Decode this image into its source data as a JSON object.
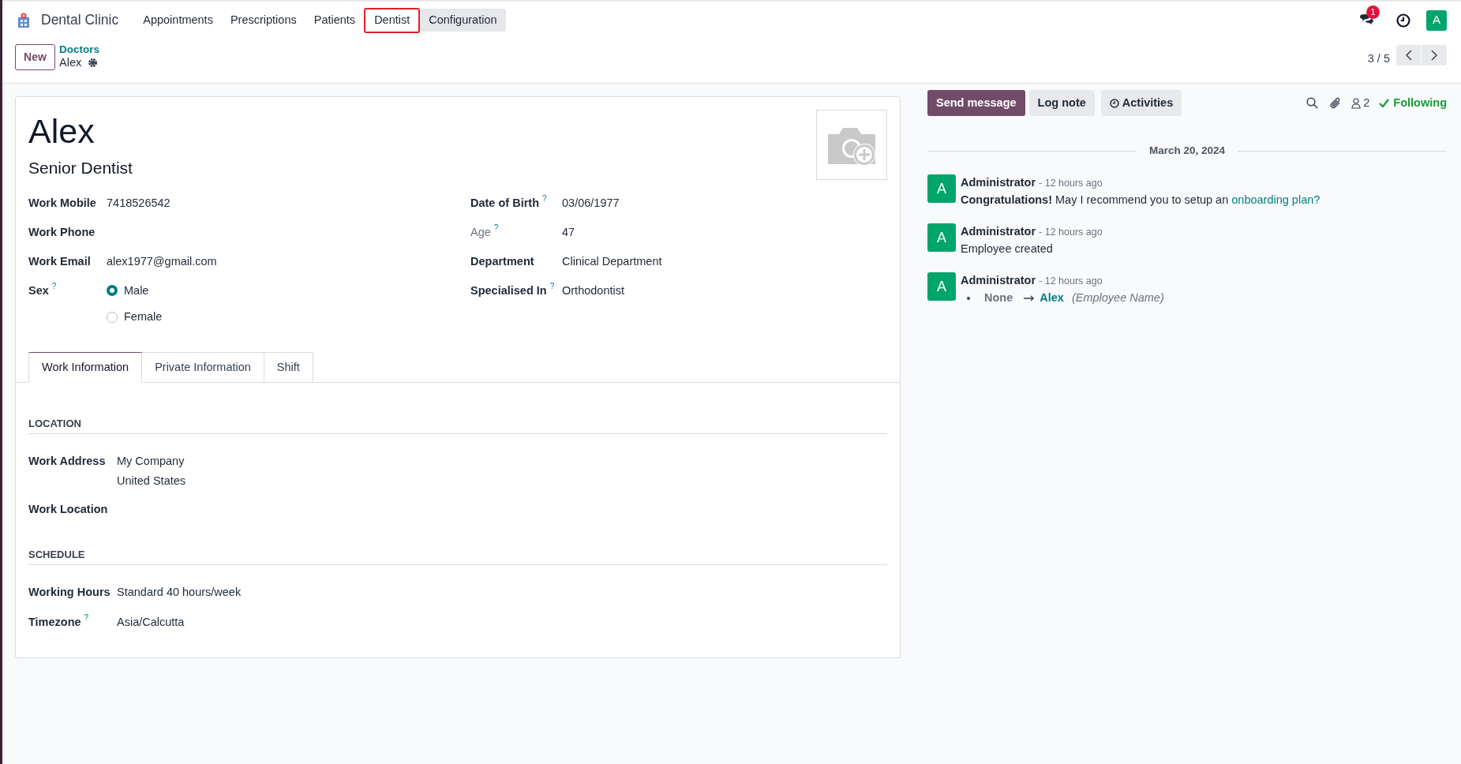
{
  "navbar": {
    "app_name": "Dental Clinic",
    "menu": [
      {
        "label": "Appointments",
        "highlighted": false,
        "active": false
      },
      {
        "label": "Prescriptions",
        "highlighted": false,
        "active": false
      },
      {
        "label": "Patients",
        "highlighted": false,
        "active": false
      },
      {
        "label": "Dentist",
        "highlighted": true,
        "active": false
      },
      {
        "label": "Configuration",
        "highlighted": false,
        "active": true
      }
    ],
    "message_count": "1",
    "avatar": "A"
  },
  "control_panel": {
    "new_button": "New",
    "breadcrumb": "Doctors",
    "record": "Alex",
    "pager": "3 / 5"
  },
  "form": {
    "name": "Alex",
    "job_title": "Senior Dentist",
    "left_fields": [
      {
        "kind": "text",
        "label": "Work Mobile",
        "value": "7418526542"
      },
      {
        "kind": "text",
        "label": "Work Phone"
      },
      {
        "kind": "text",
        "label": "Work Email",
        "value": "alex1977@gmail.com"
      },
      {
        "kind": "radio",
        "label": "Sex",
        "help": "?",
        "options": [
          {
            "label": "Male",
            "selected": true
          },
          {
            "label": "Female",
            "selected": false
          }
        ]
      }
    ],
    "right_fields": [
      {
        "kind": "text",
        "label": "Date of Birth",
        "help": "?",
        "value": "03/06/1977",
        "readonly": false
      },
      {
        "kind": "text",
        "label": "Age",
        "help": "?",
        "value": "47",
        "readonly": true
      },
      {
        "kind": "text",
        "label": "Department",
        "value": "Clinical Department",
        "readonly": false
      },
      {
        "kind": "text",
        "label": "Specialised In",
        "help": "?",
        "value": "Orthodontist",
        "readonly": false
      }
    ],
    "tabs": [
      {
        "label": "Work Information",
        "selected": true
      },
      {
        "label": "Private Information",
        "selected": false
      },
      {
        "label": "Shift",
        "selected": false
      }
    ],
    "sections": [
      {
        "title": "LOCATION",
        "fields": [
          {
            "label": "Work Address",
            "lines": [
              "My Company",
              "United States"
            ]
          },
          {
            "label": "Work Location"
          }
        ]
      },
      {
        "title": "SCHEDULE",
        "fields": [
          {
            "label": "Working Hours",
            "lines": [
              "Standard 40 hours/week"
            ]
          },
          {
            "label": "Timezone",
            "help": "?",
            "lines": [
              "Asia/Calcutta"
            ]
          }
        ]
      }
    ]
  },
  "chatter": {
    "send_message": "Send message",
    "log_note": "Log note",
    "activities": "Activities",
    "followers": "2",
    "following": "Following",
    "date": "March 20, 2024",
    "messages": [
      {
        "kind": "text",
        "avatar": "A",
        "author": "Administrator",
        "time": "- 12 hours ago",
        "body": "**Congratulations!** May I recommend you to setup an ",
        "link": "onboarding plan?"
      },
      {
        "kind": "text",
        "avatar": "A",
        "author": "Administrator",
        "time": "- 12 hours ago",
        "body": "Employee created"
      },
      {
        "kind": "tracking",
        "avatar": "A",
        "author": "Administrator",
        "time": "- 12 hours ago",
        "old": "None",
        "new": "Alex",
        "field": "(Employee Name)"
      }
    ]
  }
}
